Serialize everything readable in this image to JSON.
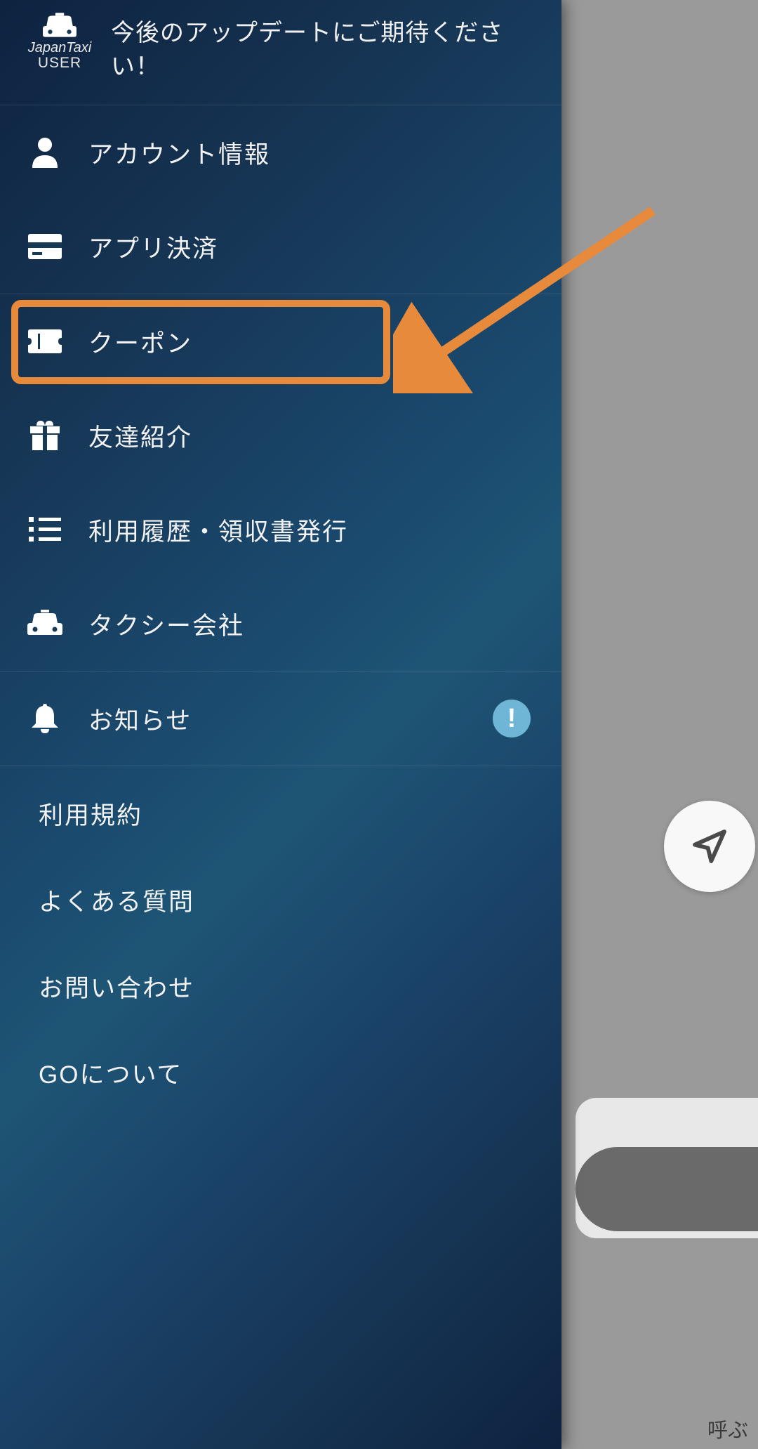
{
  "header": {
    "logo_text": "JapanTaxi",
    "logo_sub": "USER",
    "message": "今後のアップデートにご期待ください！"
  },
  "menu": {
    "section1": [
      {
        "icon": "person-icon",
        "label": "アカウント情報"
      },
      {
        "icon": "card-icon",
        "label": "アプリ決済"
      }
    ],
    "section2": [
      {
        "icon": "coupon-icon",
        "label": "クーポン",
        "highlighted": true
      },
      {
        "icon": "gift-icon",
        "label": "友達紹介"
      },
      {
        "icon": "list-icon",
        "label": "利用履歴・領収書発行"
      },
      {
        "icon": "taxi-icon",
        "label": "タクシー会社"
      }
    ],
    "section3": [
      {
        "icon": "bell-icon",
        "label": "お知らせ",
        "badge": "!"
      }
    ]
  },
  "links": [
    "利用規約",
    "よくある質問",
    "お問い合わせ",
    "GOについて"
  ],
  "background": {
    "partial_button_text": "呼ぶ"
  },
  "annotation": {
    "highlight_color": "#e88a3c",
    "arrow_color": "#e88a3c"
  }
}
